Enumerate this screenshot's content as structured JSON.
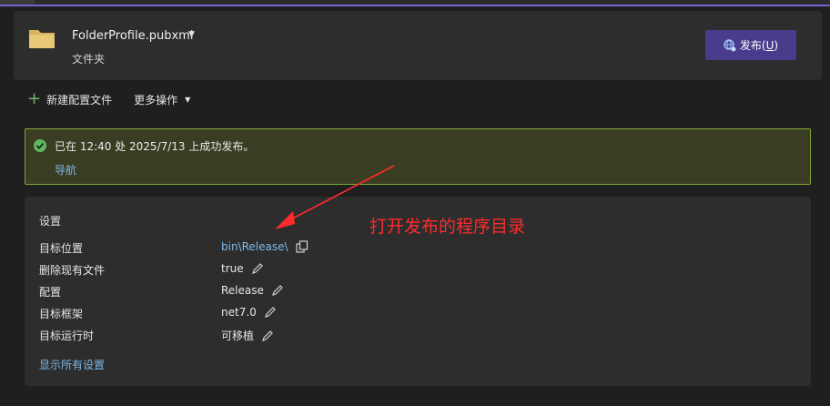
{
  "profile": {
    "name": "FolderProfile.pubxml",
    "type": "文件夹",
    "publish_label": "发布(",
    "publish_hotkey": "U",
    "publish_suffix": ")"
  },
  "toolbar": {
    "new_profile": "新建配置文件",
    "more_actions": "更多操作"
  },
  "status": {
    "message": "已在 12:40 处 2025/7/13 上成功发布。",
    "nav_link": "导航"
  },
  "settings": {
    "title": "设置",
    "rows": [
      {
        "label": "目标位置",
        "value": "bin\\Release\\"
      },
      {
        "label": "删除现有文件",
        "value": "true"
      },
      {
        "label": "配置",
        "value": "Release"
      },
      {
        "label": "目标框架",
        "value": "net7.0"
      },
      {
        "label": "目标运行时",
        "value": "可移植"
      }
    ],
    "show_all": "显示所有设置"
  },
  "annotation": {
    "text": "打开发布的程序目录",
    "color": "#ff2b2b"
  },
  "colors": {
    "accent": "#7a5fd0",
    "publish_button": "#4a3c8c",
    "success_border": "#7fa832",
    "link": "#7fb8e8"
  }
}
